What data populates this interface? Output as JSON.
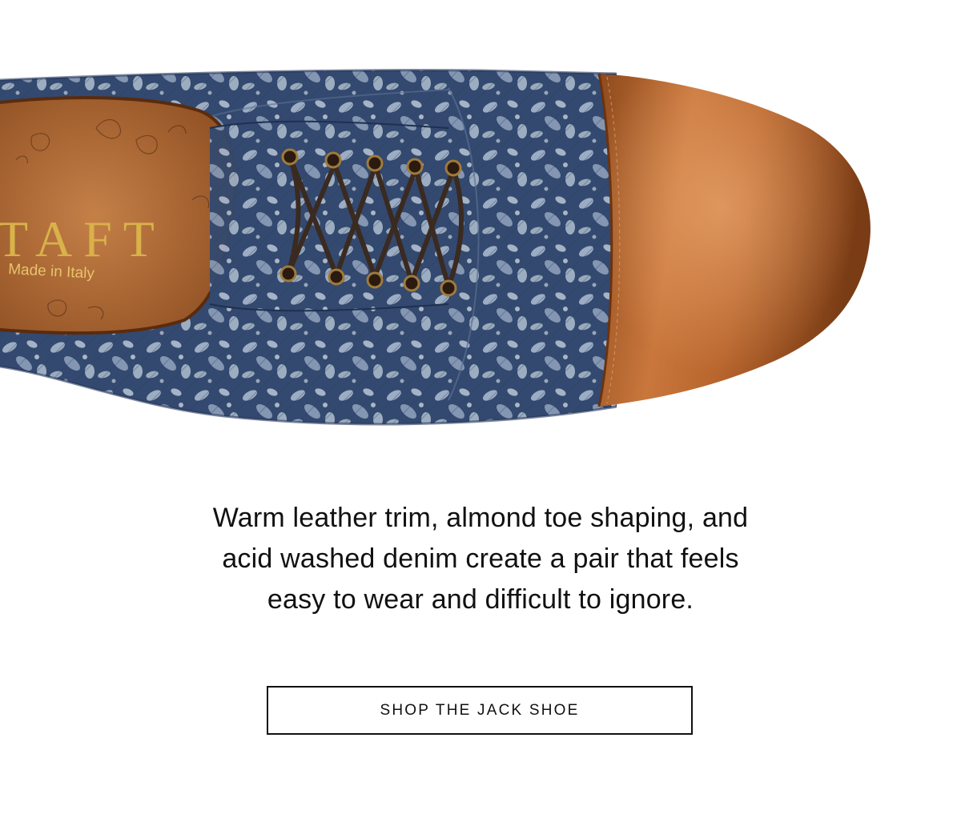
{
  "hero": {
    "insole_brand_text": "TAFT",
    "insole_origin_text": "Made in Italy",
    "image_subject": "Jack shoe — acid washed floral denim derby with tan leather cap toe, top view"
  },
  "colors": {
    "denim_dark": "#2f456c",
    "denim_light": "#b4c3d3",
    "leather_tan": "#b0612c",
    "leather_dark": "#7a3c15",
    "insole": "#b46f3c",
    "gold_foil": "#d8b24a",
    "lace": "#3a2a20",
    "text": "#111111",
    "background": "#ffffff"
  },
  "content": {
    "description_line_1": "Warm leather trim, almond toe shaping, and",
    "description_line_2": "acid washed denim create a pair that feels",
    "description_line_3": "easy to wear and difficult to ignore."
  },
  "cta": {
    "label": "SHOP THE JACK SHOE"
  }
}
